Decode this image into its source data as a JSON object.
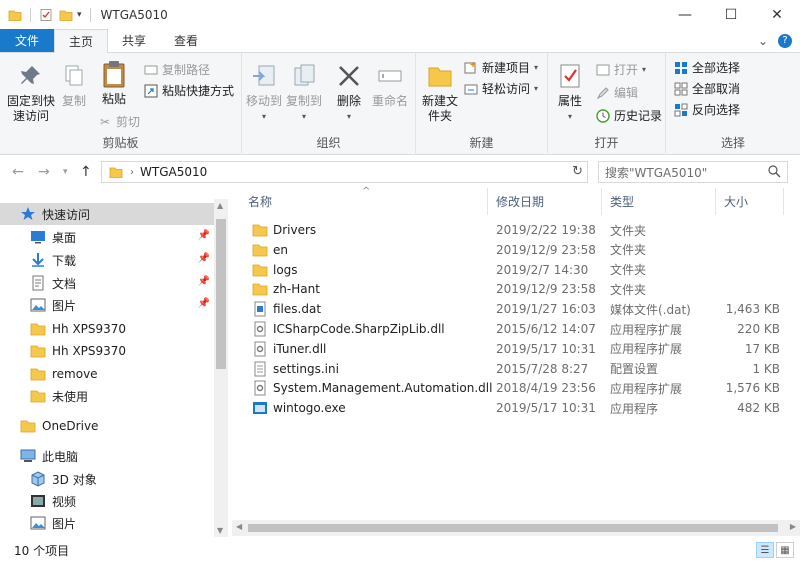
{
  "window": {
    "title": "WTGA5010",
    "minimize": "—",
    "maximize": "☐",
    "close": "✕"
  },
  "tabs": {
    "file": "文件",
    "home": "主页",
    "share": "共享",
    "view": "查看"
  },
  "ribbon": {
    "clipboard": {
      "label": "剪贴板",
      "pin_quick": "固定到快速访问",
      "copy": "复制",
      "paste": "粘贴",
      "copy_path": "复制路径",
      "paste_shortcut": "粘贴快捷方式",
      "cut": "剪切"
    },
    "organize": {
      "label": "组织",
      "move_to": "移动到",
      "copy_to": "复制到",
      "delete": "删除",
      "rename": "重命名"
    },
    "new": {
      "label": "新建",
      "new_folder": "新建文件夹",
      "new_item": "新建项目",
      "easy_access": "轻松访问"
    },
    "open": {
      "label": "打开",
      "properties": "属性",
      "open": "打开",
      "edit": "编辑",
      "history": "历史记录"
    },
    "select": {
      "label": "选择",
      "select_all": "全部选择",
      "select_none": "全部取消",
      "invert": "反向选择"
    }
  },
  "address": {
    "path": "WTGA5010",
    "search_placeholder": "搜索\"WTGA5010\""
  },
  "nav": {
    "items": [
      {
        "label": "快速访问",
        "icon": "star-icon",
        "pinned": false
      },
      {
        "label": "桌面",
        "icon": "desktop-icon",
        "pinned": true
      },
      {
        "label": "下载",
        "icon": "download-icon",
        "pinned": true
      },
      {
        "label": "文档",
        "icon": "document-icon",
        "pinned": true
      },
      {
        "label": "图片",
        "icon": "picture-icon",
        "pinned": true
      },
      {
        "label": "Hh XPS9370",
        "icon": "folder-icon",
        "pinned": false
      },
      {
        "label": "Hh XPS9370",
        "icon": "folder-icon",
        "pinned": false
      },
      {
        "label": "remove",
        "icon": "folder-icon",
        "pinned": false
      },
      {
        "label": "未使用",
        "icon": "folder-icon",
        "pinned": false
      },
      {
        "label": "OneDrive",
        "icon": "folder-icon",
        "pinned": false
      },
      {
        "label": "此电脑",
        "icon": "computer-icon",
        "pinned": false
      },
      {
        "label": "3D 对象",
        "icon": "3d-objects-icon",
        "pinned": false
      },
      {
        "label": "视频",
        "icon": "video-icon",
        "pinned": false
      },
      {
        "label": "图片",
        "icon": "picture-icon",
        "pinned": false
      }
    ]
  },
  "columns": {
    "name": "名称",
    "date": "修改日期",
    "type": "类型",
    "size": "大小"
  },
  "files": [
    {
      "name": "Drivers",
      "date": "2019/2/22 19:38",
      "type": "文件夹",
      "size": "",
      "icon": "folder-icon"
    },
    {
      "name": "en",
      "date": "2019/12/9 23:58",
      "type": "文件夹",
      "size": "",
      "icon": "folder-icon"
    },
    {
      "name": "logs",
      "date": "2019/2/7 14:30",
      "type": "文件夹",
      "size": "",
      "icon": "folder-icon"
    },
    {
      "name": "zh-Hant",
      "date": "2019/12/9 23:58",
      "type": "文件夹",
      "size": "",
      "icon": "folder-icon"
    },
    {
      "name": "files.dat",
      "date": "2019/1/27 16:03",
      "type": "媒体文件(.dat)",
      "size": "1,463 KB",
      "icon": "media-file-icon"
    },
    {
      "name": "ICSharpCode.SharpZipLib.dll",
      "date": "2015/6/12 14:07",
      "type": "应用程序扩展",
      "size": "220 KB",
      "icon": "dll-file-icon"
    },
    {
      "name": "iTuner.dll",
      "date": "2019/5/17 10:31",
      "type": "应用程序扩展",
      "size": "17 KB",
      "icon": "dll-file-icon"
    },
    {
      "name": "settings.ini",
      "date": "2015/7/28 8:27",
      "type": "配置设置",
      "size": "1 KB",
      "icon": "ini-file-icon"
    },
    {
      "name": "System.Management.Automation.dll",
      "date": "2018/4/19 23:56",
      "type": "应用程序扩展",
      "size": "1,576 KB",
      "icon": "dll-file-icon"
    },
    {
      "name": "wintogo.exe",
      "date": "2019/5/17 10:31",
      "type": "应用程序",
      "size": "482 KB",
      "icon": "exe-file-icon"
    }
  ],
  "status": {
    "count": "10 个项目"
  },
  "colors": {
    "accent": "#1979ca",
    "folder": "#f5c84c"
  }
}
